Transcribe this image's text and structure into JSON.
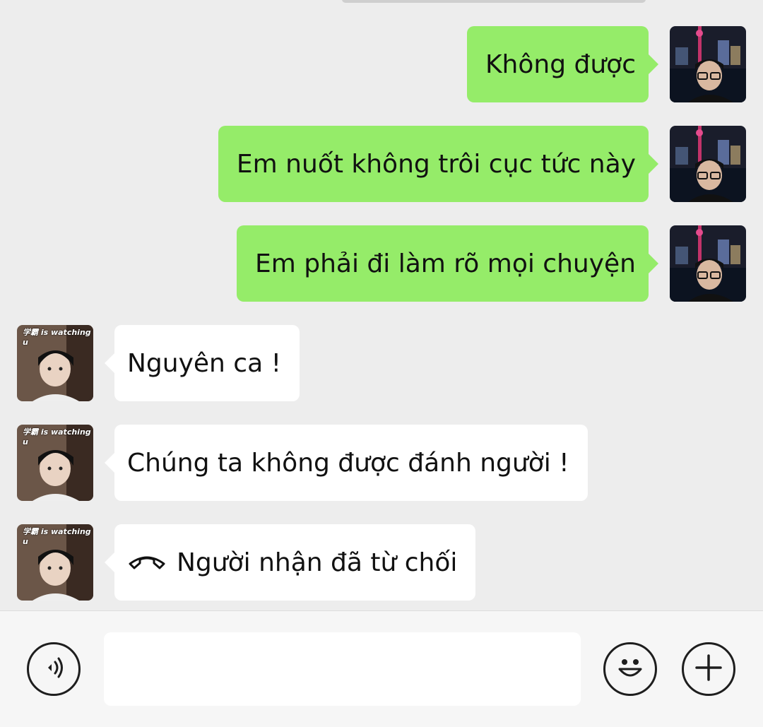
{
  "messages": [
    {
      "side": "right",
      "text": "Không được"
    },
    {
      "side": "right",
      "text": "Em nuốt không trôi cục tức này"
    },
    {
      "side": "right",
      "text": "Em phải đi làm rõ mọi chuyện"
    },
    {
      "side": "left",
      "text": "Nguyên ca !"
    },
    {
      "side": "left",
      "text": "Chúng ta không được đánh người !"
    },
    {
      "side": "left",
      "text": "Người nhận đã từ chối",
      "icon": "call-declined-icon"
    }
  ],
  "contact_avatar_caption": "学霸 is watching u",
  "input": {
    "value": "",
    "placeholder": ""
  },
  "icons": {
    "voice": "voice-icon",
    "emoji": "emoji-icon",
    "more": "plus-icon"
  },
  "colors": {
    "sent_bubble": "#95ec69",
    "received_bubble": "#ffffff",
    "background": "#ededed"
  }
}
